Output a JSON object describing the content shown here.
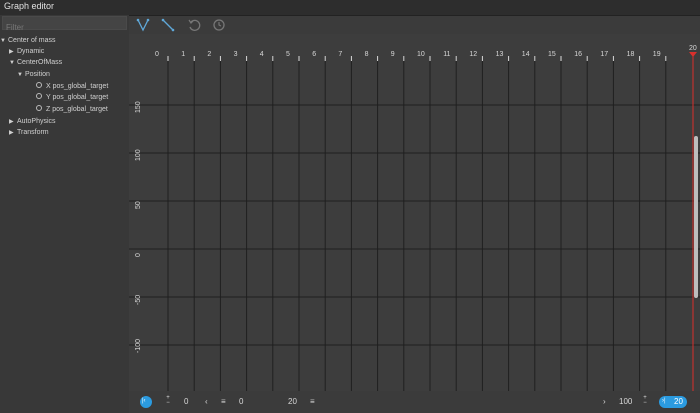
{
  "window": {
    "title": "Graph editor"
  },
  "filter": {
    "placeholder": "Filter",
    "value": ""
  },
  "tree": [
    {
      "label": "Center of mass",
      "expanded": true
    },
    {
      "label": "Dynamic",
      "expanded": false
    },
    {
      "label": "CenterOfMass",
      "expanded": true
    },
    {
      "label": "Position",
      "expanded": true
    },
    {
      "label": "X pos_global_target"
    },
    {
      "label": "Y pos_global_target"
    },
    {
      "label": "Z pos_global_target"
    },
    {
      "label": "AutoPhysics",
      "expanded": false
    },
    {
      "label": "Transform",
      "expanded": false
    }
  ],
  "toolbar": [
    "curve-tangent-icon",
    "linear-tangent-icon",
    "undo-icon",
    "redo-icon"
  ],
  "graph": {
    "x_ticks": [
      "0",
      "1",
      "2",
      "3",
      "4",
      "5",
      "6",
      "7",
      "8",
      "9",
      "10",
      "11",
      "12",
      "13",
      "14",
      "15",
      "16",
      "17",
      "18",
      "19"
    ],
    "y_ticks": [
      "150",
      "100",
      "50",
      "0",
      "-50",
      "-100"
    ],
    "current_frame": "20",
    "playhead_color": "#d9302c",
    "accent": "#2b9be0"
  },
  "bottom": {
    "range_start": "0",
    "range_start2": "0",
    "range_end": "20",
    "zoom": "100",
    "current": "20",
    "plus": "+",
    "minus": "−",
    "prev_glyph": "‹",
    "next_glyph": "›",
    "menu_glyph": "≡",
    "first_glyph": "|‹",
    "last_glyph": "›|"
  }
}
